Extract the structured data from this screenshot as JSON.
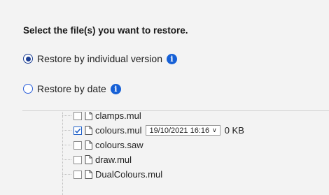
{
  "heading": "Select the file(s) you want to restore.",
  "options": [
    {
      "label": "Restore by individual version",
      "selected": true
    },
    {
      "label": "Restore by date",
      "selected": false
    }
  ],
  "info_icon_glyph": "i",
  "files": [
    {
      "name": "clamps.mul",
      "checked": false
    },
    {
      "name": "colours.mul",
      "checked": true,
      "version": "19/10/2021 16:16",
      "size": "0 KB"
    },
    {
      "name": "colours.saw",
      "checked": false
    },
    {
      "name": "draw.mul",
      "checked": false
    },
    {
      "name": "DualColours.mul",
      "checked": false
    }
  ],
  "colors": {
    "accent": "#1660d6",
    "radio_selected": "#1c3f94"
  }
}
